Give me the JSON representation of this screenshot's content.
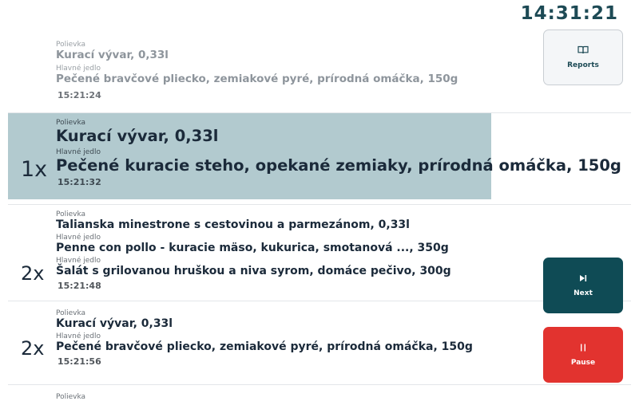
{
  "clock": "14:31:21",
  "buttons": {
    "reports": "Reports",
    "next": "Next",
    "pause": "Pause"
  },
  "orders": [
    {
      "count": "",
      "lines": [
        {
          "category": "Polievka",
          "item": "Kurací vývar, 0,33l"
        },
        {
          "category": "Hlavné jedlo",
          "item": "Pečené bravčové pliecko, zemiakové pyré, prírodná omáčka, 150g"
        }
      ],
      "time": "15:21:24"
    },
    {
      "count": "1x",
      "lines": [
        {
          "category": "Polievka",
          "item": "Kurací vývar, 0,33l"
        },
        {
          "category": "Hlavné jedlo",
          "item": "Pečené kuracie steho, opekané zemiaky, prírodná omáčka, 150g"
        }
      ],
      "time": "15:21:32"
    },
    {
      "count": "2x",
      "lines": [
        {
          "category": "Polievka",
          "item": "Talianska minestrone s cestovinou a parmezánom, 0,33l"
        },
        {
          "category": "Hlavné jedlo",
          "item": "Penne con pollo - kuracie mäso, kukurica, smotanová ..., 350g"
        },
        {
          "category": "Hlavné jedlo",
          "item": "Šalát s grilovanou hruškou a niva syrom, domáce pečivo, 300g"
        }
      ],
      "time": "15:21:48"
    },
    {
      "count": "2x",
      "lines": [
        {
          "category": "Polievka",
          "item": "Kurací vývar, 0,33l"
        },
        {
          "category": "Hlavné jedlo",
          "item": "Pečené bravčové pliecko, zemiakové pyré, prírodná omáčka, 150g"
        }
      ],
      "time": "15:21:56"
    },
    {
      "count": "",
      "lines": [
        {
          "category": "Polievka"
        }
      ]
    }
  ],
  "colors": {
    "accent": "#0f4b55",
    "highlight": "#b2cacf",
    "pause": "#e2332f"
  }
}
